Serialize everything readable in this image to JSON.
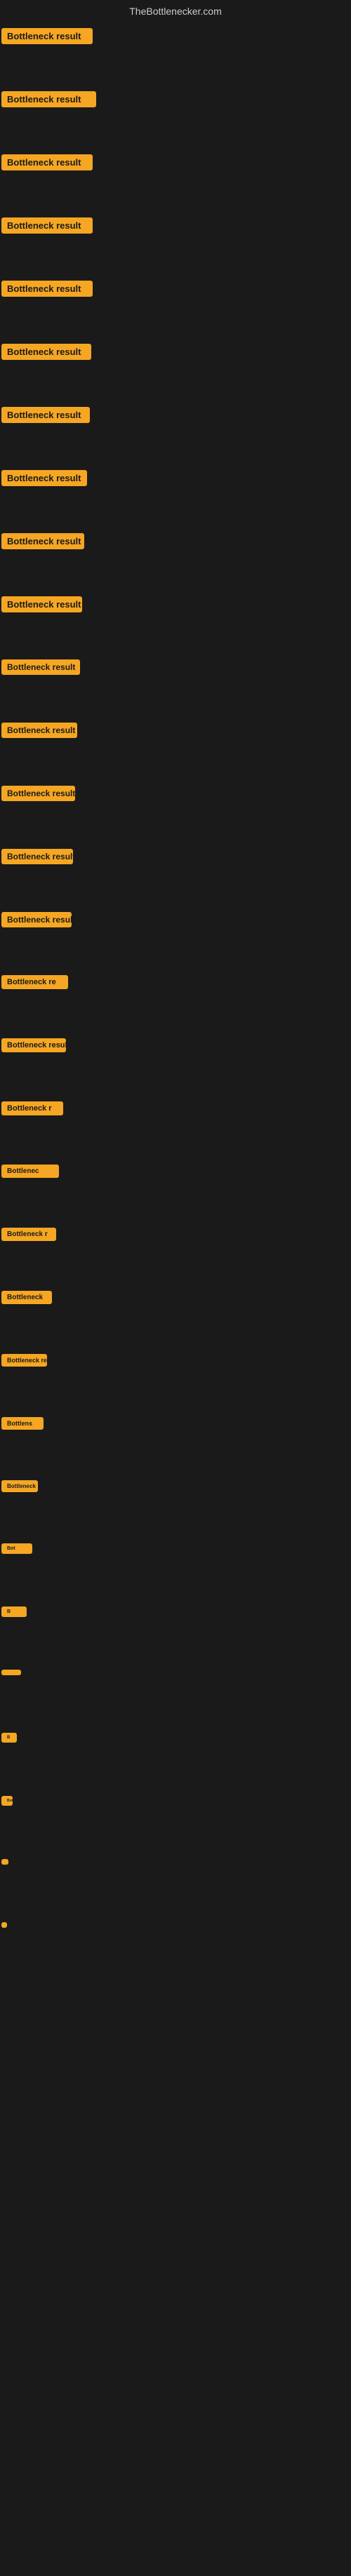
{
  "header": {
    "title": "TheBottlenecker.com"
  },
  "items": [
    {
      "id": 1,
      "label": "Bottleneck result",
      "row_class": "row-1"
    },
    {
      "id": 2,
      "label": "Bottleneck result",
      "row_class": "row-2"
    },
    {
      "id": 3,
      "label": "Bottleneck result",
      "row_class": "row-3"
    },
    {
      "id": 4,
      "label": "Bottleneck result",
      "row_class": "row-4"
    },
    {
      "id": 5,
      "label": "Bottleneck result",
      "row_class": "row-5"
    },
    {
      "id": 6,
      "label": "Bottleneck result",
      "row_class": "row-6"
    },
    {
      "id": 7,
      "label": "Bottleneck result",
      "row_class": "row-7"
    },
    {
      "id": 8,
      "label": "Bottleneck result",
      "row_class": "row-8"
    },
    {
      "id": 9,
      "label": "Bottleneck result",
      "row_class": "row-9"
    },
    {
      "id": 10,
      "label": "Bottleneck result",
      "row_class": "row-10"
    },
    {
      "id": 11,
      "label": "Bottleneck result",
      "row_class": "row-11"
    },
    {
      "id": 12,
      "label": "Bottleneck result",
      "row_class": "row-12"
    },
    {
      "id": 13,
      "label": "Bottleneck result",
      "row_class": "row-13"
    },
    {
      "id": 14,
      "label": "Bottleneck result",
      "row_class": "row-14"
    },
    {
      "id": 15,
      "label": "Bottleneck result",
      "row_class": "row-15"
    },
    {
      "id": 16,
      "label": "Bottleneck re",
      "row_class": "row-16"
    },
    {
      "id": 17,
      "label": "Bottleneck result",
      "row_class": "row-17"
    },
    {
      "id": 18,
      "label": "Bottleneck r",
      "row_class": "row-18"
    },
    {
      "id": 19,
      "label": "Bottlenec",
      "row_class": "row-19"
    },
    {
      "id": 20,
      "label": "Bottleneck r",
      "row_class": "row-20"
    },
    {
      "id": 21,
      "label": "Bottleneck",
      "row_class": "row-21"
    },
    {
      "id": 22,
      "label": "Bottleneck res",
      "row_class": "row-22"
    },
    {
      "id": 23,
      "label": "Bottlens",
      "row_class": "row-23"
    },
    {
      "id": 24,
      "label": "Bottleneck",
      "row_class": "row-24"
    },
    {
      "id": 25,
      "label": "Bot",
      "row_class": "row-25"
    },
    {
      "id": 26,
      "label": "B",
      "row_class": "row-26"
    },
    {
      "id": 27,
      "label": "",
      "row_class": "row-27"
    },
    {
      "id": 28,
      "label": "B",
      "row_class": "row-28"
    },
    {
      "id": 29,
      "label": "Bott",
      "row_class": "row-29"
    },
    {
      "id": 30,
      "label": "",
      "row_class": "row-30"
    },
    {
      "id": 31,
      "label": "",
      "row_class": "row-31"
    }
  ]
}
